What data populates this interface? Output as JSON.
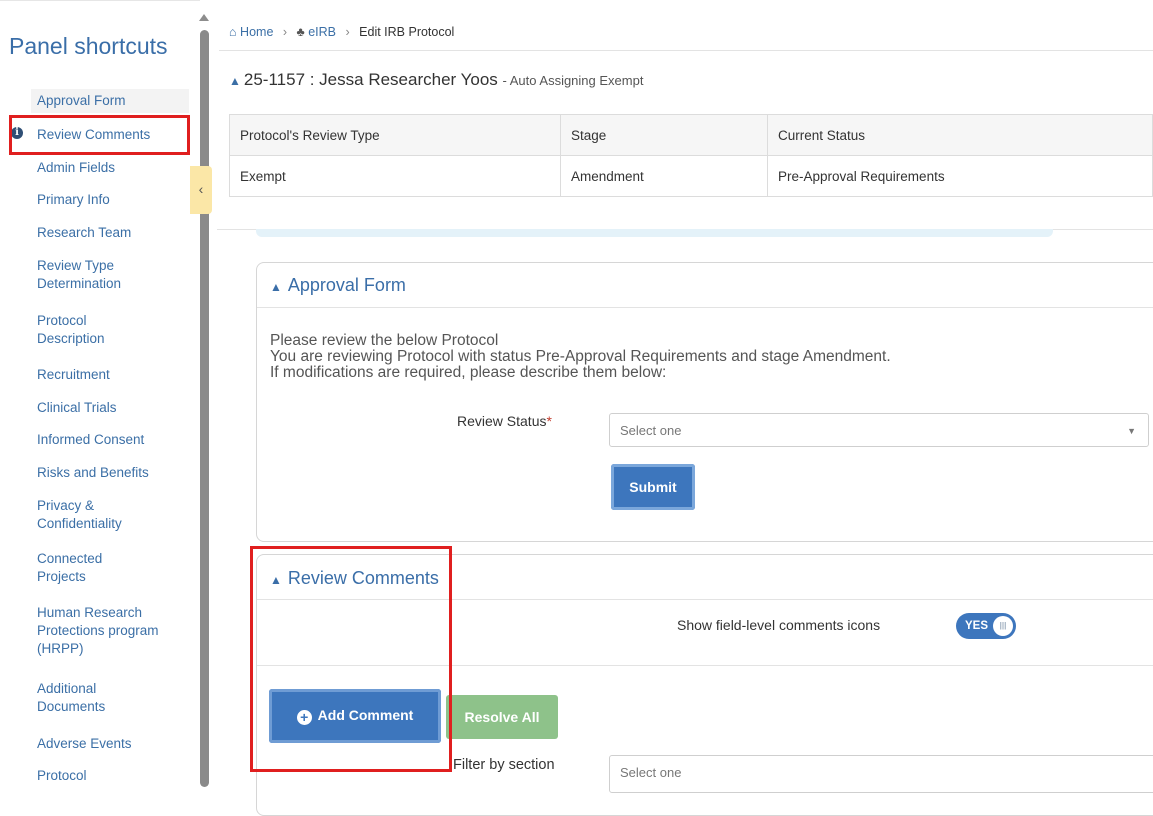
{
  "sidebar": {
    "title": "Panel shortcuts",
    "items": [
      {
        "label": "Approval Form"
      },
      {
        "label": "Review Comments"
      },
      {
        "label": "Admin Fields"
      },
      {
        "label": "Primary Info"
      },
      {
        "label": "Research Team"
      },
      {
        "label": "Review Type Determination"
      },
      {
        "label": "Protocol Description"
      },
      {
        "label": "Recruitment"
      },
      {
        "label": "Clinical Trials"
      },
      {
        "label": "Informed Consent"
      },
      {
        "label": "Risks and Benefits"
      },
      {
        "label": "Privacy & Confidentiality"
      },
      {
        "label": "Connected Projects"
      },
      {
        "label": "Human Research Protections program (HRPP)"
      },
      {
        "label": "Additional Documents"
      },
      {
        "label": "Adverse Events"
      },
      {
        "label": "Protocol"
      }
    ]
  },
  "breadcrumb": {
    "home": "Home",
    "eirb": "eIRB",
    "current": "Edit IRB Protocol"
  },
  "header": {
    "title": "25-1157 : Jessa Researcher Yoos",
    "subtitle": "- Auto Assigning Exempt"
  },
  "status_table": {
    "headers": [
      "Protocol's Review Type",
      "Stage",
      "Current Status"
    ],
    "row": [
      "Exempt",
      "Amendment",
      "Pre-Approval Requirements"
    ]
  },
  "approval_form": {
    "title": "Approval Form",
    "line1": "Please review the below Protocol",
    "line2": "You are reviewing Protocol with status Pre-Approval Requirements and stage Amendment.",
    "line3": "If modifications are required, please describe them below:",
    "review_status_label": "Review Status",
    "required_mark": "*",
    "review_status_placeholder": "Select one",
    "submit_label": "Submit"
  },
  "review_comments": {
    "title": "Review Comments",
    "show_icons_label": "Show field-level comments icons",
    "toggle_label": "YES",
    "toggle_state": "on",
    "add_comment_label": "Add Comment",
    "resolve_all_label": "Resolve All",
    "filter_label": "Filter by section",
    "filter_placeholder": "Select one"
  },
  "colors": {
    "accent": "#3d76bd",
    "link": "#3b6fa6",
    "highlight": "#e01f1f",
    "resolve": "#8ec28a"
  }
}
